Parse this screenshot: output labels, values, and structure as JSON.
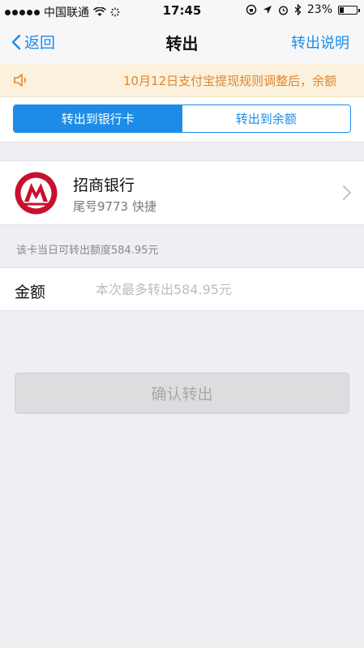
{
  "status_bar": {
    "carrier": "中国联通",
    "time": "17:45",
    "battery": "23%"
  },
  "nav": {
    "back_label": "返回",
    "title": "转出",
    "right_label": "转出说明"
  },
  "notice": {
    "text": "10月12日支付宝提现规则调整后，余额"
  },
  "tabs": [
    {
      "label": "转出到银行卡",
      "active": true
    },
    {
      "label": "转出到余额",
      "active": false
    }
  ],
  "bank": {
    "name": "招商银行",
    "sub": "尾号9773 快捷"
  },
  "limit_text": "该卡当日可转出额度584.95元",
  "amount": {
    "label": "金额",
    "placeholder": "本次最多转出584.95元",
    "value": ""
  },
  "confirm_label": "确认转出",
  "colors": {
    "accent": "#1c8ce8",
    "notice_text": "#e0872d",
    "notice_bg": "#fbf1dd",
    "bank_brand": "#c8102e"
  }
}
